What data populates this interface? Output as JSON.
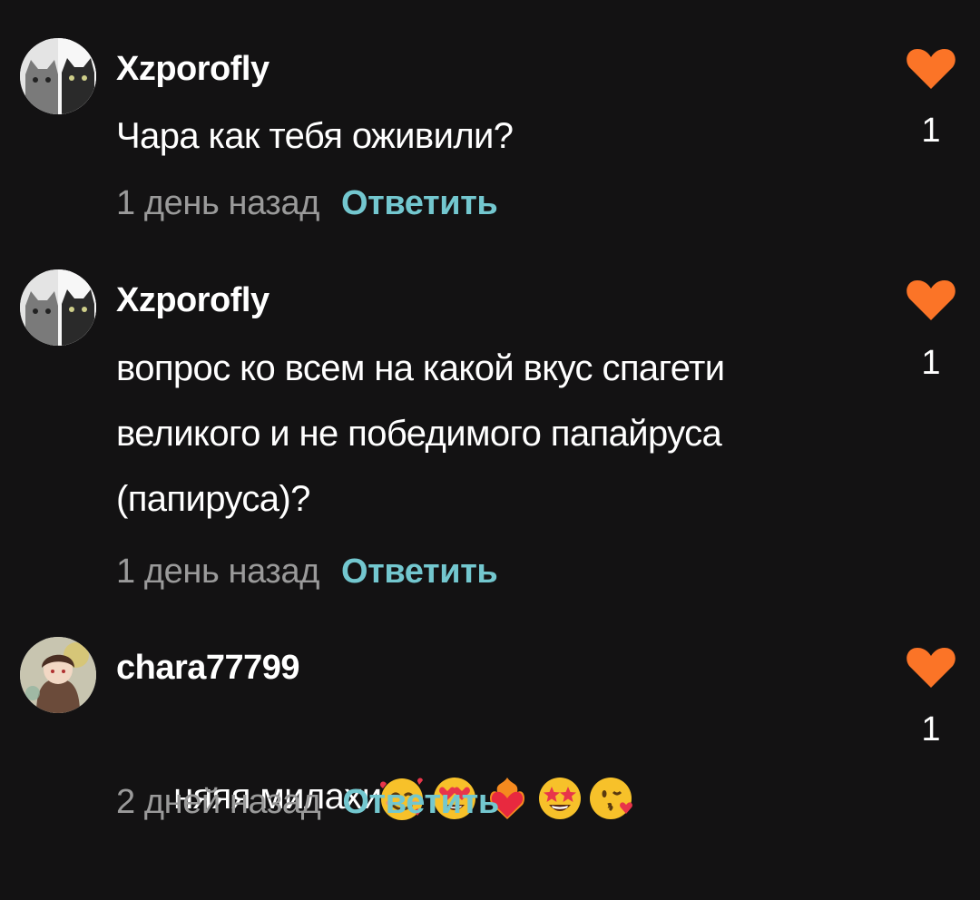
{
  "comments": [
    {
      "username": "Xzporofly",
      "text": "Чара как тебя оживили?",
      "time": "1 день назад",
      "reply_label": "Ответить",
      "likes": "1",
      "avatar_icon": "cat-pair-avatar"
    },
    {
      "username": "Xzporofly",
      "text": "вопрос ко всем на какой вкус спагети\nвеликого и не победимого папайруса\n(папируса)?",
      "time": "1 день назад",
      "reply_label": "Ответить",
      "likes": "1",
      "avatar_icon": "cat-pair-avatar"
    },
    {
      "username": "chara77799",
      "text": "няяя милахи",
      "emojis": [
        "smiling-face-with-hearts",
        "heart-eyes",
        "heart-on-fire",
        "star-struck",
        "face-blowing-kiss"
      ],
      "time": "2 дней назад",
      "reply_label": "Ответить",
      "likes": "1",
      "avatar_icon": "anime-character-avatar"
    }
  ],
  "colors": {
    "background": "#131213",
    "text": "#ffffff",
    "timestamp": "#9a9a9a",
    "reply_link": "#73c7cf",
    "like_heart": "#fb7427"
  }
}
